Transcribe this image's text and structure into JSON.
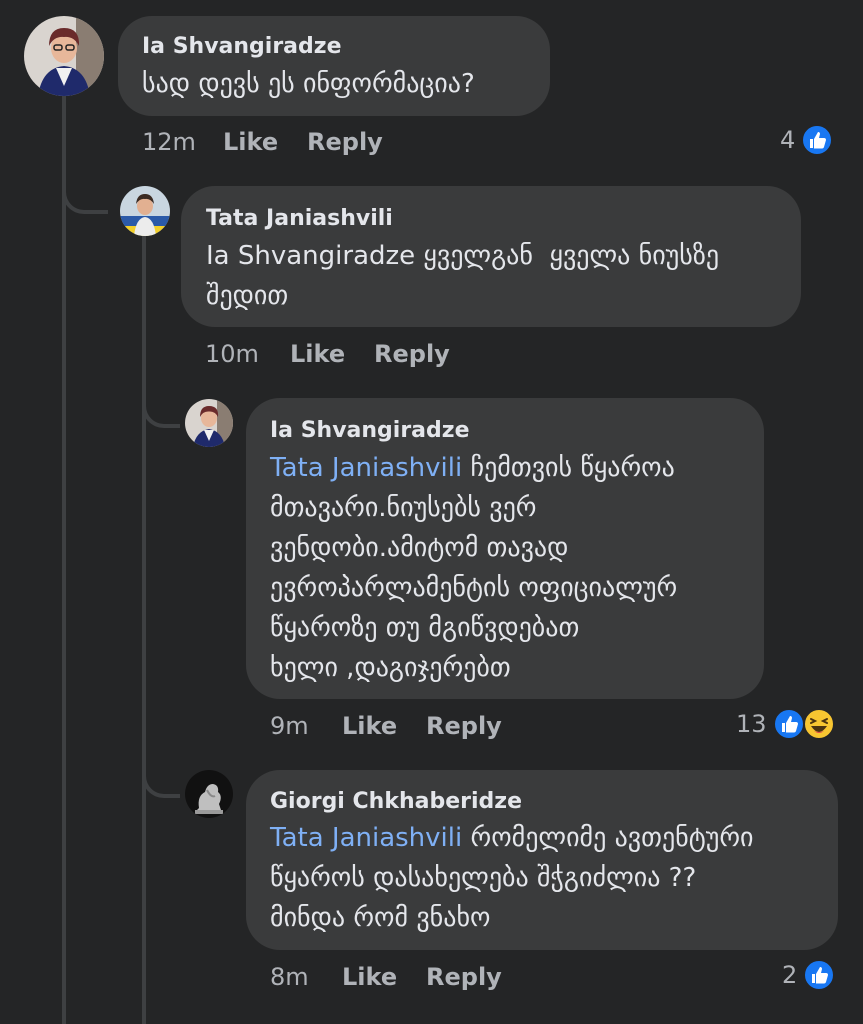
{
  "comments": [
    {
      "author": "Ia Shvangiradze",
      "text_lines": [
        "სად დევს ეს ინფორმაცია?"
      ],
      "time": "12m",
      "like_label": "Like",
      "reply_label": "Reply",
      "reaction_count": "4",
      "reactions": [
        "like-icon"
      ]
    },
    {
      "author": "Tata Janiashvili",
      "text_lines": [
        "Ia Shvangiradze ყველგან  ყველა ნიუსზე",
        "შედით"
      ],
      "time": "10m",
      "like_label": "Like",
      "reply_label": "Reply"
    },
    {
      "author": "Ia Shvangiradze",
      "mention": "Tata Janiashvili",
      "first_line_rest": " ჩემთვის წყაროა",
      "text_lines": [
        "მთავარი.ნიუსებს ვერ",
        "ვენდობი.ამიტომ თავად",
        "ევროპარლამენტის ოფიციალურ",
        "წყაროზე თუ მგიწვდებათ",
        "ხელი ,დაგიჯერებთ"
      ],
      "time": "9m",
      "like_label": "Like",
      "reply_label": "Reply",
      "reaction_count": "13",
      "reactions": [
        "like-icon",
        "haha-icon"
      ]
    },
    {
      "author": "Giorgi Chkhaberidze",
      "mention": "Tata Janiashvili",
      "first_line_rest": " რომელიმე ავთენტური",
      "text_lines": [
        "წყაროს დასახელება შჭგიძლია ??",
        "მინდა რომ ვნახო"
      ],
      "time": "8m",
      "like_label": "Like",
      "reply_label": "Reply",
      "reaction_count": "2",
      "reactions": [
        "like-icon"
      ]
    }
  ],
  "colors": {
    "background": "#242526",
    "bubble": "#3a3b3c",
    "text": "#e4e6eb",
    "secondary_text": "#b0b3b8",
    "mention": "#7fb0f5",
    "like_blue": "#1877f2",
    "haha_yellow": "#f7c531"
  }
}
